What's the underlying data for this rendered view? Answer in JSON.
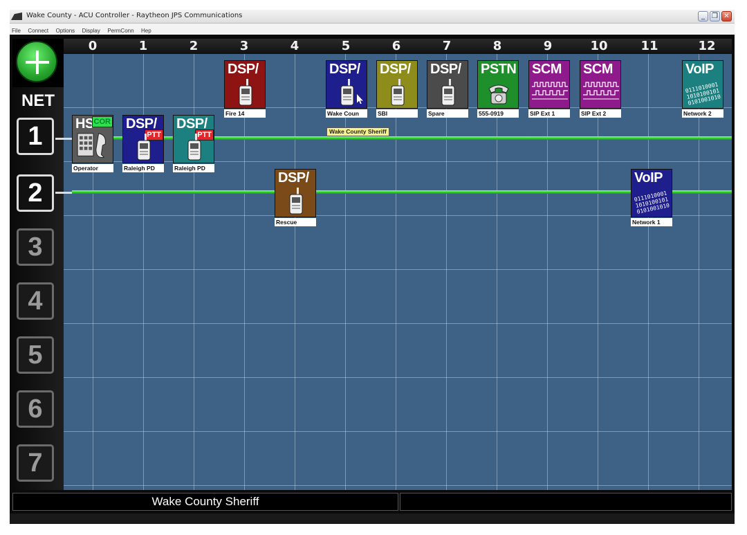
{
  "window": {
    "title": "Wake County - ACU Controller - Raytheon JPS Communications",
    "minimize": "_",
    "restore": "❐",
    "close": "✕"
  },
  "menu": [
    "File",
    "Connect",
    "Options",
    "Display",
    "PermConn",
    "Hep"
  ],
  "columns": [
    "0",
    "1",
    "2",
    "3",
    "4",
    "5",
    "6",
    "7",
    "8",
    "9",
    "10",
    "11",
    "12"
  ],
  "net": {
    "label": "NET",
    "buttons": [
      "1",
      "2",
      "3",
      "4",
      "5",
      "6",
      "7"
    ],
    "active": [
      1,
      2
    ]
  },
  "devices": {
    "operator": {
      "title": "HS",
      "badge": "COR",
      "label": "Operator",
      "color": "#5a5a5a"
    },
    "raleigh_pd_1": {
      "title": "DSP/",
      "badge": "PTT",
      "label": "Raleigh PD",
      "color": "#1e1e8c"
    },
    "raleigh_pd_2": {
      "title": "DSP/",
      "badge": "PTT",
      "label": "Raleigh PD",
      "color": "#1d8080"
    },
    "fire14": {
      "title": "DSP/",
      "label": "Fire 14",
      "color": "#8e1414"
    },
    "wake_county": {
      "title": "DSP/",
      "label": "Wake Coun",
      "color": "#1e1e8c"
    },
    "sbi": {
      "title": "DSP/",
      "label": "SBI",
      "color": "#8e8c1a"
    },
    "spare": {
      "title": "DSP/",
      "label": "Spare",
      "color": "#4b4b4b"
    },
    "pstn": {
      "title": "PSTN",
      "label": "555-0919",
      "color": "#1f8f2c"
    },
    "scm1": {
      "title": "SCM",
      "label": "SIP Ext 1",
      "color": "#8e1a8c"
    },
    "scm2": {
      "title": "SCM",
      "label": "SIP Ext 2",
      "color": "#8e1a8c"
    },
    "voip2": {
      "title": "VoIP",
      "label": "Network 2",
      "color": "#1d8080"
    },
    "rescue": {
      "title": "DSP/",
      "label": "Rescue",
      "color": "#7a4a18"
    },
    "voip1": {
      "title": "VoIP",
      "label": "Network 1",
      "color": "#1e1e8c"
    }
  },
  "tooltip": "Wake County Sheriff",
  "status": {
    "left": "Wake County Sheriff",
    "right": ""
  }
}
